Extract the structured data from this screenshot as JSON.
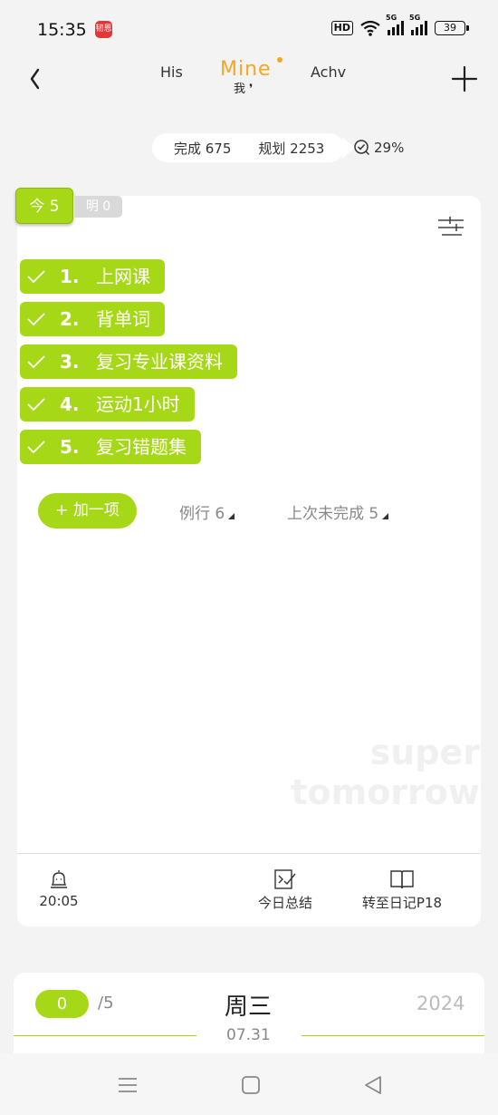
{
  "status_bar": {
    "time": "15:35",
    "app_icon_label": "韧恩",
    "hd_label": "HD",
    "network_1": "5G",
    "network_2": "5G",
    "battery": "39"
  },
  "header": {
    "his": "His",
    "mine": "Mine",
    "mine_sub": "我",
    "achv": "Achv"
  },
  "stats": {
    "done_label": "完成 675",
    "plan_label": "规划 2253",
    "rate": "29%"
  },
  "tabs": {
    "today": "今 5",
    "tomorrow": "明 0"
  },
  "tasks": [
    {
      "num": "1.",
      "text": "上网课"
    },
    {
      "num": "2.",
      "text": "背单词"
    },
    {
      "num": "3.",
      "text": "复习专业课资料"
    },
    {
      "num": "4.",
      "text": "运动1小时"
    },
    {
      "num": "5.",
      "text": "复习错题集"
    }
  ],
  "actions": {
    "add_item": "+ 加一项",
    "routine": "例行 6",
    "unfinished": "上次未完成 5"
  },
  "watermark": {
    "line1": "super",
    "line2": "tomorrow"
  },
  "footer": {
    "alarm_time": "20:05",
    "summary": "今日总结",
    "diary": "转至日记P18"
  },
  "day_card": {
    "done_count": "0",
    "total": "/5",
    "weekday": "周三",
    "year": "2024",
    "date": "07.31"
  },
  "colors": {
    "accent": "#a6d817",
    "mine": "#f5a623"
  }
}
